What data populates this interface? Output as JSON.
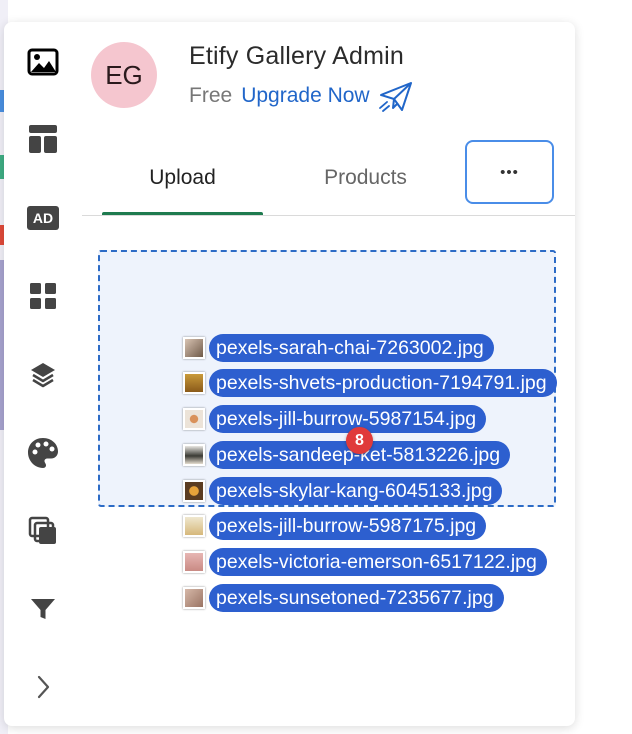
{
  "header": {
    "avatar_initials": "EG",
    "title": "Etify Gallery Admin",
    "plan": "Free",
    "upgrade_label": "Upgrade Now"
  },
  "tabs": [
    {
      "label": "Upload",
      "active": true
    },
    {
      "label": "Products",
      "active": false
    }
  ],
  "more_label": "•••",
  "drag": {
    "count": "8",
    "files": [
      {
        "name": "pexels-sarah-chai-7263002.jpg"
      },
      {
        "name": "pexels-shvets-production-7194791.jpg"
      },
      {
        "name": "pexels-jill-burrow-5987154.jpg"
      },
      {
        "name": "pexels-sandeep-ket-5813226.jpg"
      },
      {
        "name": "pexels-skylar-kang-6045133.jpg"
      },
      {
        "name": "pexels-jill-burrow-5987175.jpg"
      },
      {
        "name": "pexels-victoria-emerson-6517122.jpg"
      },
      {
        "name": "pexels-sunsetoned-7235677.jpg"
      }
    ]
  },
  "sidebar": {
    "icons": [
      "image-icon",
      "template-layout-icon",
      "ad-icon",
      "grid-icon",
      "layers-icon",
      "palette-icon",
      "copy-icon",
      "filter-icon",
      "chevron-right-icon"
    ],
    "ad_label": "AD"
  },
  "colors": {
    "accent": "#2166c9",
    "tab_indicator": "#1e7b4f",
    "pill": "#2d5fcf",
    "badge": "#e03a3a",
    "avatar": "#f5c6cf",
    "dropzone_border": "#2c6bc6"
  }
}
